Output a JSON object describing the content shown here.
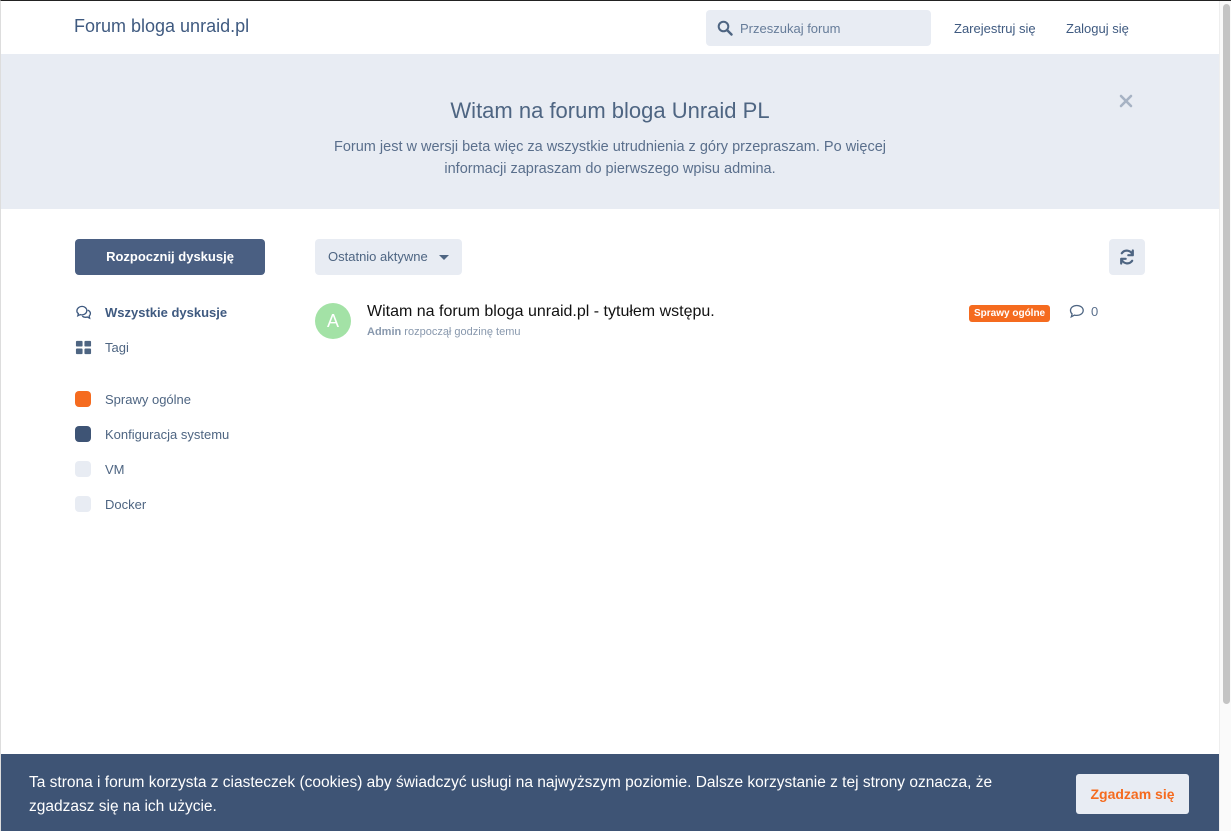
{
  "header": {
    "brand": "Forum bloga unraid.pl",
    "search_placeholder": "Przeszukaj forum",
    "register_label": "Zarejestruj się",
    "login_label": "Zaloguj się"
  },
  "hero": {
    "title": "Witam na forum bloga Unraid PL",
    "text": "Forum jest w wersji beta więc za wszystkie utrudnienia z góry przepraszam. Po więcej informacji zapraszam do pierwszego wpisu admina."
  },
  "sidebar": {
    "start_button": "Rozpocznij dyskusję",
    "nav": [
      {
        "label": "Wszystkie dyskusje",
        "icon": "comments-icon"
      },
      {
        "label": "Tagi",
        "icon": "grid-icon"
      }
    ],
    "tags": [
      {
        "label": "Sprawy ogólne",
        "color": "#f56b1f"
      },
      {
        "label": "Konfiguracja systemu",
        "color": "#3e5475"
      },
      {
        "label": "VM",
        "color": "#e8ecf3"
      },
      {
        "label": "Docker",
        "color": "#e8ecf3"
      }
    ]
  },
  "toolbar": {
    "sort_label": "Ostatnio aktywne"
  },
  "discussions": [
    {
      "avatar_letter": "A",
      "title": "Witam na forum bloga unraid.pl - tytułem wstępu.",
      "author": "Admin",
      "meta": "rozpoczął godzinę temu",
      "tag": "Sprawy ogólne",
      "replies": "0"
    }
  ],
  "cookie": {
    "text": "Ta strona i forum korzysta z ciasteczek (cookies) aby świadczyć usługi na najwyższym poziomie. Dalsze korzystanie z tej strony oznacza, że zgadzasz się na ich użycie.",
    "accept_label": "Zgadzam się"
  },
  "colors": {
    "accent": "#4a5f82",
    "tag_orange": "#f56b1f",
    "light_bg": "#e8ecf3"
  }
}
